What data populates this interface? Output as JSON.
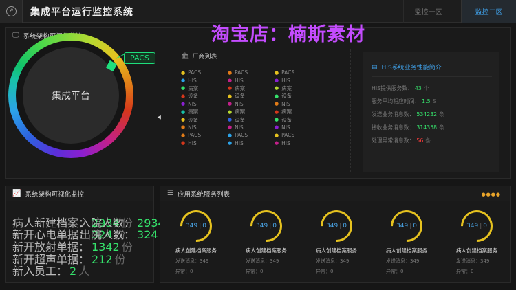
{
  "header": {
    "title": "集成平台运行监控系统",
    "tabs": [
      "监控一区",
      "监控二区"
    ],
    "active_tab": 1
  },
  "watermark": "淘宝店：楠斯素材",
  "arch_panel": {
    "title": "系统架构可视化监控",
    "ring_center": "集成平台",
    "highlight_tag": "PACS"
  },
  "vendor_list": {
    "title": "厂商列表",
    "rows": [
      [
        {
          "t": "PACS",
          "c": "#e6c21f"
        },
        {
          "t": "PACS",
          "c": "#e17b18"
        },
        {
          "t": "PACS",
          "c": "#e6c21f"
        }
      ],
      [
        {
          "t": "HIS",
          "c": "#2ca3e8"
        },
        {
          "t": "HIS",
          "c": "#c3208a"
        },
        {
          "t": "HIS",
          "c": "#8a1fd1"
        }
      ],
      [
        {
          "t": "病案",
          "c": "#35e16b"
        },
        {
          "t": "病案",
          "c": "#d6371b"
        },
        {
          "t": "病案",
          "c": "#b7d931"
        }
      ],
      [
        {
          "t": "设备",
          "c": "#d6371b"
        },
        {
          "t": "设备",
          "c": "#e6c21f"
        },
        {
          "t": "设备",
          "c": "#35e16b"
        }
      ],
      [
        {
          "t": "NIS",
          "c": "#8a1fd1"
        },
        {
          "t": "NIS",
          "c": "#c3208a"
        },
        {
          "t": "NIS",
          "c": "#e17b18"
        }
      ],
      [
        {
          "t": "病案",
          "c": "#18c2a9"
        },
        {
          "t": "病案",
          "c": "#b7d931"
        },
        {
          "t": "病案",
          "c": "#d6371b"
        }
      ],
      [
        {
          "t": "设备",
          "c": "#e6c21f"
        },
        {
          "t": "设备",
          "c": "#2d62e0"
        },
        {
          "t": "设备",
          "c": "#35e16b"
        }
      ],
      [
        {
          "t": "NIS",
          "c": "#e17b18"
        },
        {
          "t": "NIS",
          "c": "#c3208a"
        },
        {
          "t": "NIS",
          "c": "#8a1fd1"
        }
      ],
      [
        {
          "t": "PACS",
          "c": "#e17b18"
        },
        {
          "t": "PACS",
          "c": "#2ca3e8"
        },
        {
          "t": "PACS",
          "c": "#e6c21f"
        }
      ],
      [
        {
          "t": "HIS",
          "c": "#d6371b"
        },
        {
          "t": "HIS",
          "c": "#2ca3e8"
        },
        {
          "t": "HIS",
          "c": "#c3208a"
        }
      ]
    ]
  },
  "his_panel": {
    "title": "HIS系统业务性能簡介",
    "rows": [
      {
        "label": "HIS提供服务数：",
        "value": "43",
        "unit": "个",
        "color": "#35e16b"
      },
      {
        "label": "服务平均相应时间：",
        "value": "1.5",
        "unit": "S",
        "color": "#35e16b"
      },
      {
        "label": "发送业务消息数：",
        "value": "534232",
        "unit": "条",
        "color": "#35e16b"
      },
      {
        "label": "接收业务消息数：",
        "value": "314358",
        "unit": "条",
        "color": "#35e16b"
      },
      {
        "label": "处理异常消息数：",
        "value": "56",
        "unit": "条",
        "color": "#ff3b3b"
      }
    ]
  },
  "stats_panel": {
    "title": "系统架构可视化监控",
    "items": [
      {
        "label": "病人新建档案：",
        "value": "2934",
        "unit": "份"
      },
      {
        "label": "入院人数：",
        "value": "2934",
        "unit": "份"
      },
      {
        "label": "新开心电单据：",
        "value": "324",
        "unit": "份"
      },
      {
        "label": "出院人数：",
        "value": "324",
        "unit": "份"
      },
      {
        "label": "新开放射单据：",
        "value": "1342",
        "unit": "份"
      },
      {
        "label": "新开超声单据：",
        "value": "212",
        "unit": "份"
      },
      {
        "label": "新入员工：",
        "value": "2",
        "unit": "人"
      }
    ]
  },
  "service_panel": {
    "title": "应用系统服务列表",
    "services": [
      {
        "count": "349",
        "errors": "0",
        "name": "病人创建档案服务",
        "sent": "发送消息：349",
        "abnormal": "异常：0"
      },
      {
        "count": "349",
        "errors": "0",
        "name": "病人创建档案服务",
        "sent": "发送消息：349",
        "abnormal": "异常：0"
      },
      {
        "count": "349",
        "errors": "0",
        "name": "病人创建档案服务",
        "sent": "发送消息：349",
        "abnormal": "异常：0"
      },
      {
        "count": "349",
        "errors": "0",
        "name": "病人创建档案服务",
        "sent": "发送消息：349",
        "abnormal": "异常：0"
      },
      {
        "count": "349",
        "errors": "0",
        "name": "病人创建档案服务",
        "sent": "发送消息：349",
        "abnormal": "异常：0"
      }
    ]
  }
}
